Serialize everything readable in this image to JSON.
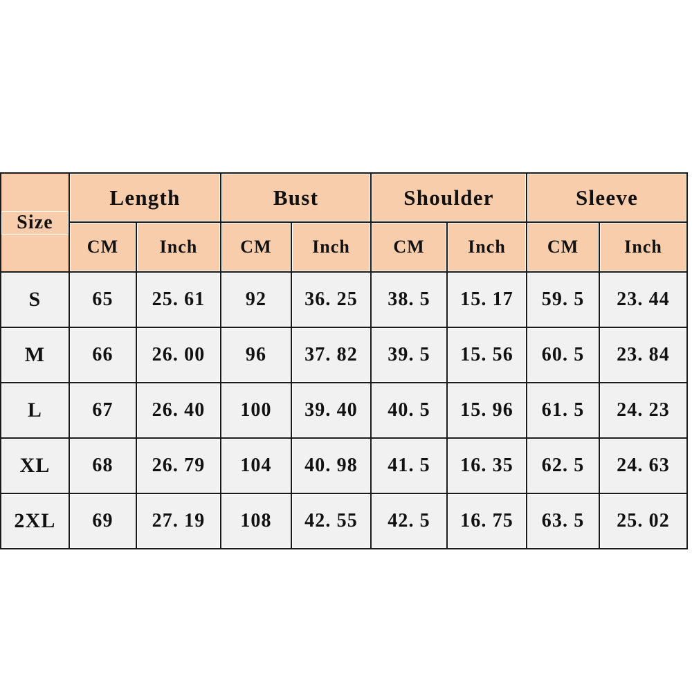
{
  "page": {
    "background_color": "#ffffff",
    "header_fill": "#f8cdab",
    "cell_fill": "#f1f1f1",
    "border_color": "#1a1a1a",
    "size_label_color": "#fc1505"
  },
  "table": {
    "size_header": "Size",
    "groups": [
      {
        "label": "Length"
      },
      {
        "label": "Bust"
      },
      {
        "label": "Shoulder"
      },
      {
        "label": "Sleeve"
      }
    ],
    "units": [
      "CM",
      "Inch",
      "CM",
      "Inch",
      "CM",
      "Inch",
      "CM",
      "Inch"
    ],
    "rows": [
      {
        "size": "S",
        "length_cm": "65",
        "length_in": "25. 61",
        "bust_cm": "92",
        "bust_in": "36. 25",
        "shoulder_cm": "38. 5",
        "shoulder_in": "15. 17",
        "sleeve_cm": "59. 5",
        "sleeve_in": "23. 44"
      },
      {
        "size": "M",
        "length_cm": "66",
        "length_in": "26. 00",
        "bust_cm": "96",
        "bust_in": "37. 82",
        "shoulder_cm": "39. 5",
        "shoulder_in": "15. 56",
        "sleeve_cm": "60. 5",
        "sleeve_in": "23. 84"
      },
      {
        "size": "L",
        "length_cm": "67",
        "length_in": "26. 40",
        "bust_cm": "100",
        "bust_in": "39. 40",
        "shoulder_cm": "40. 5",
        "shoulder_in": "15. 96",
        "sleeve_cm": "61. 5",
        "sleeve_in": "24. 23"
      },
      {
        "size": "XL",
        "length_cm": "68",
        "length_in": "26. 79",
        "bust_cm": "104",
        "bust_in": "40. 98",
        "shoulder_cm": "41. 5",
        "shoulder_in": "16. 35",
        "sleeve_cm": "62. 5",
        "sleeve_in": "24. 63"
      },
      {
        "size": "2XL",
        "length_cm": "69",
        "length_in": "27. 19",
        "bust_cm": "108",
        "bust_in": "42. 55",
        "shoulder_cm": "42. 5",
        "shoulder_in": "16. 75",
        "sleeve_cm": "63. 5",
        "sleeve_in": "25. 02"
      }
    ]
  },
  "chart_data": {
    "type": "table",
    "title": "Size Chart",
    "columns": [
      "Size",
      "Length CM",
      "Length Inch",
      "Bust CM",
      "Bust Inch",
      "Shoulder CM",
      "Shoulder Inch",
      "Sleeve CM",
      "Sleeve Inch"
    ],
    "rows": [
      [
        "S",
        65,
        25.61,
        92,
        36.25,
        38.5,
        15.17,
        59.5,
        23.44
      ],
      [
        "M",
        66,
        26.0,
        96,
        37.82,
        39.5,
        15.56,
        60.5,
        23.84
      ],
      [
        "L",
        67,
        26.4,
        100,
        39.4,
        40.5,
        15.96,
        61.5,
        24.23
      ],
      [
        "XL",
        68,
        26.79,
        104,
        40.98,
        41.5,
        16.35,
        62.5,
        24.63
      ],
      [
        "2XL",
        69,
        27.19,
        108,
        42.55,
        42.5,
        16.75,
        63.5,
        25.02
      ]
    ]
  }
}
